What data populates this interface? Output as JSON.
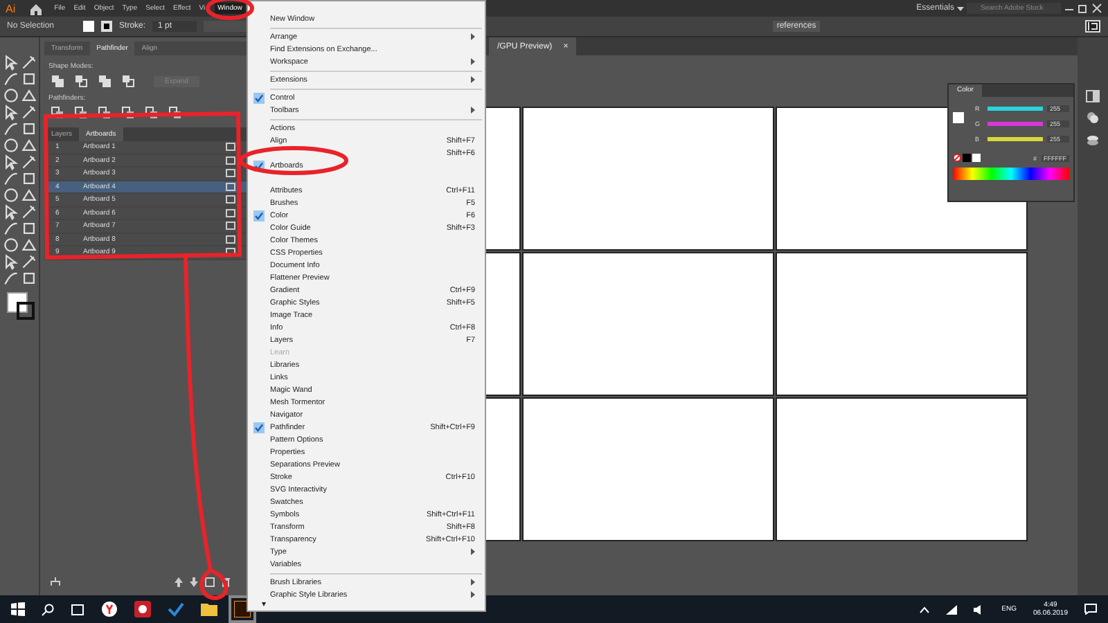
{
  "menubar": {
    "logo": "Ai",
    "items": [
      {
        "label": "File",
        "selected": false
      },
      {
        "label": "Edit",
        "selected": false
      },
      {
        "label": "Object",
        "selected": false
      },
      {
        "label": "Type",
        "selected": false
      },
      {
        "label": "Select",
        "selected": false
      },
      {
        "label": "Effect",
        "selected": false
      },
      {
        "label": "Vi",
        "selected": false
      },
      {
        "label": "Window",
        "selected": true
      }
    ],
    "workspace": "Essentials",
    "search": {
      "placeholder": "Search Adobe Stock"
    }
  },
  "control_bar": {
    "selection": "No Selection",
    "stroke_label": "Stroke:",
    "stroke_value": "1 pt",
    "preferences": "references"
  },
  "panel": {
    "tabs": [
      {
        "label": "Transform",
        "selected": false
      },
      {
        "label": "Pathfinder",
        "selected": true
      },
      {
        "label": "Align",
        "selected": false
      }
    ],
    "shape_modes": "Shape Modes:",
    "expand": {
      "label": "Expand",
      "disabled": true
    },
    "pathfinders": "Pathfinders:",
    "list_tabs": [
      {
        "label": "Layers",
        "selected": false
      },
      {
        "label": "Artboards",
        "selected": true
      }
    ],
    "artboards": [
      {
        "number": "1",
        "name": "Artboard 1",
        "selected": false
      },
      {
        "number": "2",
        "name": "Artboard 2",
        "selected": false
      },
      {
        "number": "3",
        "name": "Artboard 3",
        "selected": false
      },
      {
        "number": "4",
        "name": "Artboard 4",
        "selected": true
      },
      {
        "number": "5",
        "name": "Artboard 5",
        "selected": false
      },
      {
        "number": "6",
        "name": "Artboard 6",
        "selected": false
      },
      {
        "number": "7",
        "name": "Artboard 7",
        "selected": false
      },
      {
        "number": "8",
        "name": "Artboard 8",
        "selected": false
      },
      {
        "number": "9",
        "name": "Artboard 9",
        "selected": false
      }
    ]
  },
  "document_tab": {
    "title": "/GPU Preview)",
    "close": "×"
  },
  "window_menu": {
    "items": [
      {
        "kind": "item",
        "label": "New Window"
      },
      {
        "kind": "separator"
      },
      {
        "kind": "item",
        "label": "Arrange",
        "submenu": true
      },
      {
        "kind": "item",
        "label": "Find Extensions on Exchange..."
      },
      {
        "kind": "item",
        "label": "Workspace",
        "submenu": true
      },
      {
        "kind": "separator"
      },
      {
        "kind": "item",
        "label": "Extensions",
        "submenu": true
      },
      {
        "kind": "separator"
      },
      {
        "kind": "item",
        "label": "Control",
        "checked": true
      },
      {
        "kind": "item",
        "label": "Toolbars",
        "submenu": true
      },
      {
        "kind": "separator"
      },
      {
        "kind": "item",
        "label": "Actions"
      },
      {
        "kind": "item",
        "label": "Align",
        "shortcut": "Shift+F7"
      },
      {
        "kind": "item",
        "shortcut": "Shift+F6"
      },
      {
        "kind": "item",
        "label": "Artboards",
        "checked": true
      },
      {
        "kind": "item"
      },
      {
        "kind": "item",
        "label": "Attributes",
        "shortcut": "Ctrl+F11"
      },
      {
        "kind": "item",
        "label": "Brushes",
        "shortcut": "F5"
      },
      {
        "kind": "item",
        "label": "Color",
        "checked": true,
        "shortcut": "F6"
      },
      {
        "kind": "item",
        "label": "Color Guide",
        "shortcut": "Shift+F3"
      },
      {
        "kind": "item",
        "label": "Color Themes"
      },
      {
        "kind": "item",
        "label": "CSS Properties"
      },
      {
        "kind": "item",
        "label": "Document Info"
      },
      {
        "kind": "item",
        "label": "Flattener Preview"
      },
      {
        "kind": "item",
        "label": "Gradient",
        "shortcut": "Ctrl+F9"
      },
      {
        "kind": "item",
        "label": "Graphic Styles",
        "shortcut": "Shift+F5"
      },
      {
        "kind": "item",
        "label": "Image Trace"
      },
      {
        "kind": "item",
        "label": "Info",
        "shortcut": "Ctrl+F8"
      },
      {
        "kind": "item",
        "label": "Layers",
        "shortcut": "F7"
      },
      {
        "kind": "item",
        "label": "Learn",
        "disabled": true
      },
      {
        "kind": "item",
        "label": "Libraries"
      },
      {
        "kind": "item",
        "label": "Links"
      },
      {
        "kind": "item",
        "label": "Magic Wand"
      },
      {
        "kind": "item",
        "label": "Mesh Tormentor"
      },
      {
        "kind": "item",
        "label": "Navigator"
      },
      {
        "kind": "item",
        "label": "Pathfinder",
        "checked": true,
        "shortcut": "Shift+Ctrl+F9"
      },
      {
        "kind": "item",
        "label": "Pattern Options"
      },
      {
        "kind": "item",
        "label": "Properties"
      },
      {
        "kind": "item",
        "label": "Separations Preview"
      },
      {
        "kind": "item",
        "label": "Stroke",
        "shortcut": "Ctrl+F10"
      },
      {
        "kind": "item",
        "label": "SVG Interactivity"
      },
      {
        "kind": "item",
        "label": "Swatches"
      },
      {
        "kind": "item",
        "label": "Symbols",
        "shortcut": "Shift+Ctrl+F11"
      },
      {
        "kind": "item",
        "label": "Transform",
        "shortcut": "Shift+F8"
      },
      {
        "kind": "item",
        "label": "Transparency",
        "shortcut": "Shift+Ctrl+F10"
      },
      {
        "kind": "item",
        "label": "Type",
        "submenu": true
      },
      {
        "kind": "item",
        "label": "Variables"
      },
      {
        "kind": "separator"
      },
      {
        "kind": "item",
        "label": "Brush Libraries",
        "submenu": true
      },
      {
        "kind": "item",
        "label": "Graphic Style Libraries",
        "submenu": true
      }
    ],
    "scroll_arrow": "▾"
  },
  "color_panel": {
    "title": "Color",
    "channels": [
      {
        "label": "R",
        "color": "#2ad4dc",
        "level": 1,
        "value": "255"
      },
      {
        "label": "G",
        "color": "#d63ad6",
        "level": 1,
        "value": "255"
      },
      {
        "label": "B",
        "color": "#d8d83a",
        "level": 1,
        "value": "255"
      }
    ],
    "hex_label": "#",
    "hex": "FFFFFF"
  },
  "taskbar": {
    "language": "ENG",
    "time": "4:49",
    "date": "06.06.2019"
  }
}
